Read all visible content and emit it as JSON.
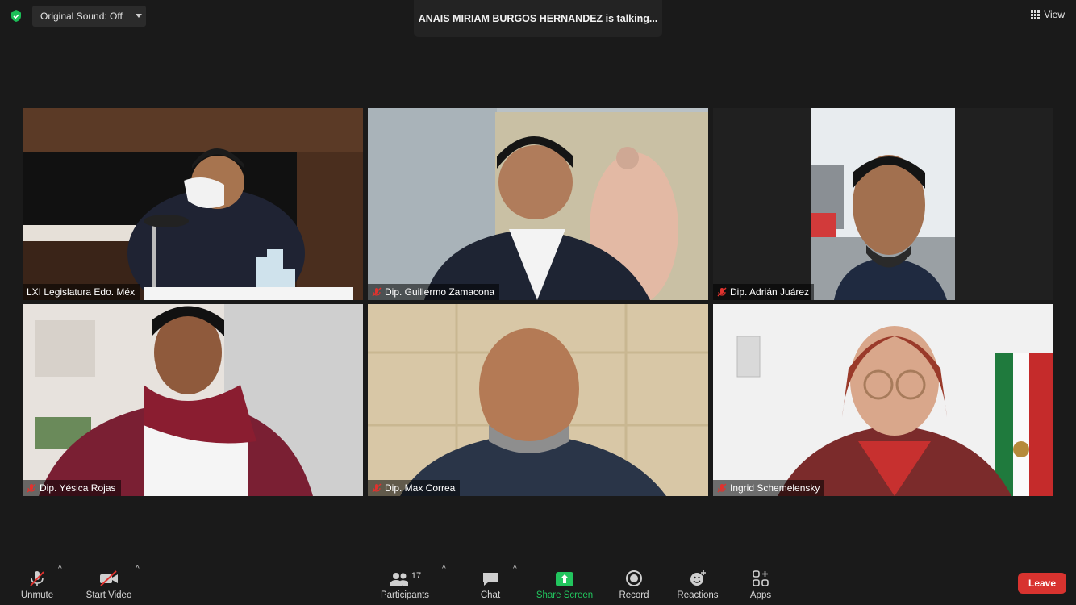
{
  "top": {
    "original_sound": "Original Sound: Off",
    "talking_banner": "ANAIS MIRIAM BURGOS HERNANDEZ is talking...",
    "view": "View"
  },
  "participants": [
    {
      "name": "LXI Legislatura Edo. Méx",
      "muted": false
    },
    {
      "name": "Dip. Guillermo Zamacona",
      "muted": true
    },
    {
      "name": "Dip. Adrián Juárez",
      "muted": true
    },
    {
      "name": "Dip. Yésica Rojas",
      "muted": true
    },
    {
      "name": "Dip. Max Correa",
      "muted": true
    },
    {
      "name": "Ingrid Schemelensky",
      "muted": true
    }
  ],
  "toolbar": {
    "unmute": "Unmute",
    "start_video": "Start Video",
    "participants_label": "Participants",
    "participants_count": "17",
    "chat": "Chat",
    "share_screen": "Share Screen",
    "record": "Record",
    "reactions": "Reactions",
    "apps": "Apps",
    "leave": "Leave"
  },
  "colors": {
    "share_screen": "#22c55e",
    "leave": "#d8332f",
    "muted_icon": "#e0322e",
    "security_shield": "#1bbf57"
  }
}
